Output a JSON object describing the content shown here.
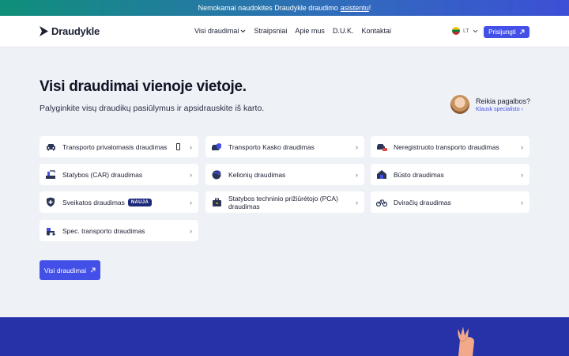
{
  "promo": {
    "text": "Nemokamai naudokites Draudykle draudimo",
    "link": "asistentu",
    "suffix": "!"
  },
  "nav": {
    "logo": "Draudykle",
    "menu": [
      "Visi draudimai",
      "Straipsniai",
      "Apie mus",
      "D.U.K.",
      "Kontaktai"
    ],
    "lang": "LT",
    "login": "Prisijungti"
  },
  "hero": {
    "title": "Visi draudimai vienoje vietoje.",
    "subtitle": "Palyginkite visų draudikų pasiūlymus ir apsidrauskite iš karto."
  },
  "help": {
    "title": "Reikia pagalbos?",
    "link": "Klausk specialisto ›"
  },
  "cards": [
    {
      "label": "Transporto privalomasis draudimas",
      "icon": "car-icon"
    },
    {
      "label": "Transporto Kasko draudimas",
      "icon": "car-shield-icon"
    },
    {
      "label": "Neregistruoto transporto draudimas",
      "icon": "car-plate-icon"
    },
    {
      "label": "Statybos (CAR) draudimas",
      "icon": "construction-icon"
    },
    {
      "label": "Kelionių draudimas",
      "icon": "globe-plane-icon"
    },
    {
      "label": "Būsto draudimas",
      "icon": "house-icon"
    },
    {
      "label": "Sveikatos draudimas",
      "icon": "health-shield-icon",
      "badge": "NAUJA"
    },
    {
      "label": "Statybos techninio prižiūrėtojo (PCA) draudimas",
      "icon": "briefcase-icon"
    },
    {
      "label": "Dviračių draudimas",
      "icon": "bicycle-icon"
    },
    {
      "label": "Spec. transporto draudimas",
      "icon": "tractor-icon"
    }
  ],
  "all_button": "Visi draudimai",
  "colors": {
    "accent": "#4350e8",
    "band": "#2832a8",
    "badge": "#1c2a7a"
  }
}
